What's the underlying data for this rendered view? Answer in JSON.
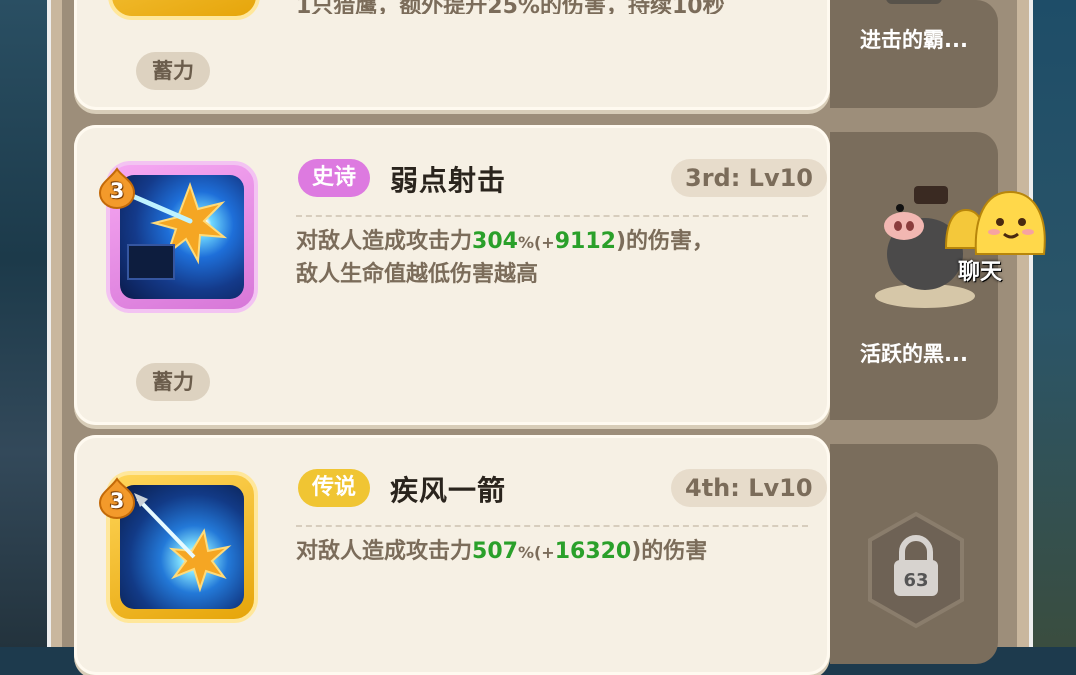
{
  "top_card": {
    "desc_partial": "1只猎鹰，额外提升25%的伤害，持续10秒",
    "charge_label": "蓄力",
    "side_label": "进击的霸..."
  },
  "cards": [
    {
      "rarity": "史诗",
      "rarity_color": "#dd7ae0",
      "name": "弱点射击",
      "level_tag": "3rd: Lv10",
      "badge_level": "3",
      "desc_prefix": "对敌人造成攻击力",
      "pct": "304",
      "pct_unit": "%(+",
      "bonus": "9112",
      "desc_mid": ")的伤害，",
      "desc_line2": "敌人生命值越低伤害越高",
      "charge_label": "蓄力",
      "side_label": "活跃的黑...",
      "side_icon": "boar-figure-icon"
    },
    {
      "rarity": "传说",
      "rarity_color": "#f0c533",
      "name": "疾风一箭",
      "level_tag": "4th: Lv10",
      "badge_level": "3",
      "desc_prefix": "对敌人造成攻击力",
      "pct": "507",
      "pct_unit": "%(+",
      "bonus": "16320",
      "desc_mid": ")的伤害",
      "side_icon": "lock-icon",
      "lock_level": "63"
    }
  ],
  "chat": {
    "label": "聊天",
    "icon": "emoji-bubble-icon"
  }
}
